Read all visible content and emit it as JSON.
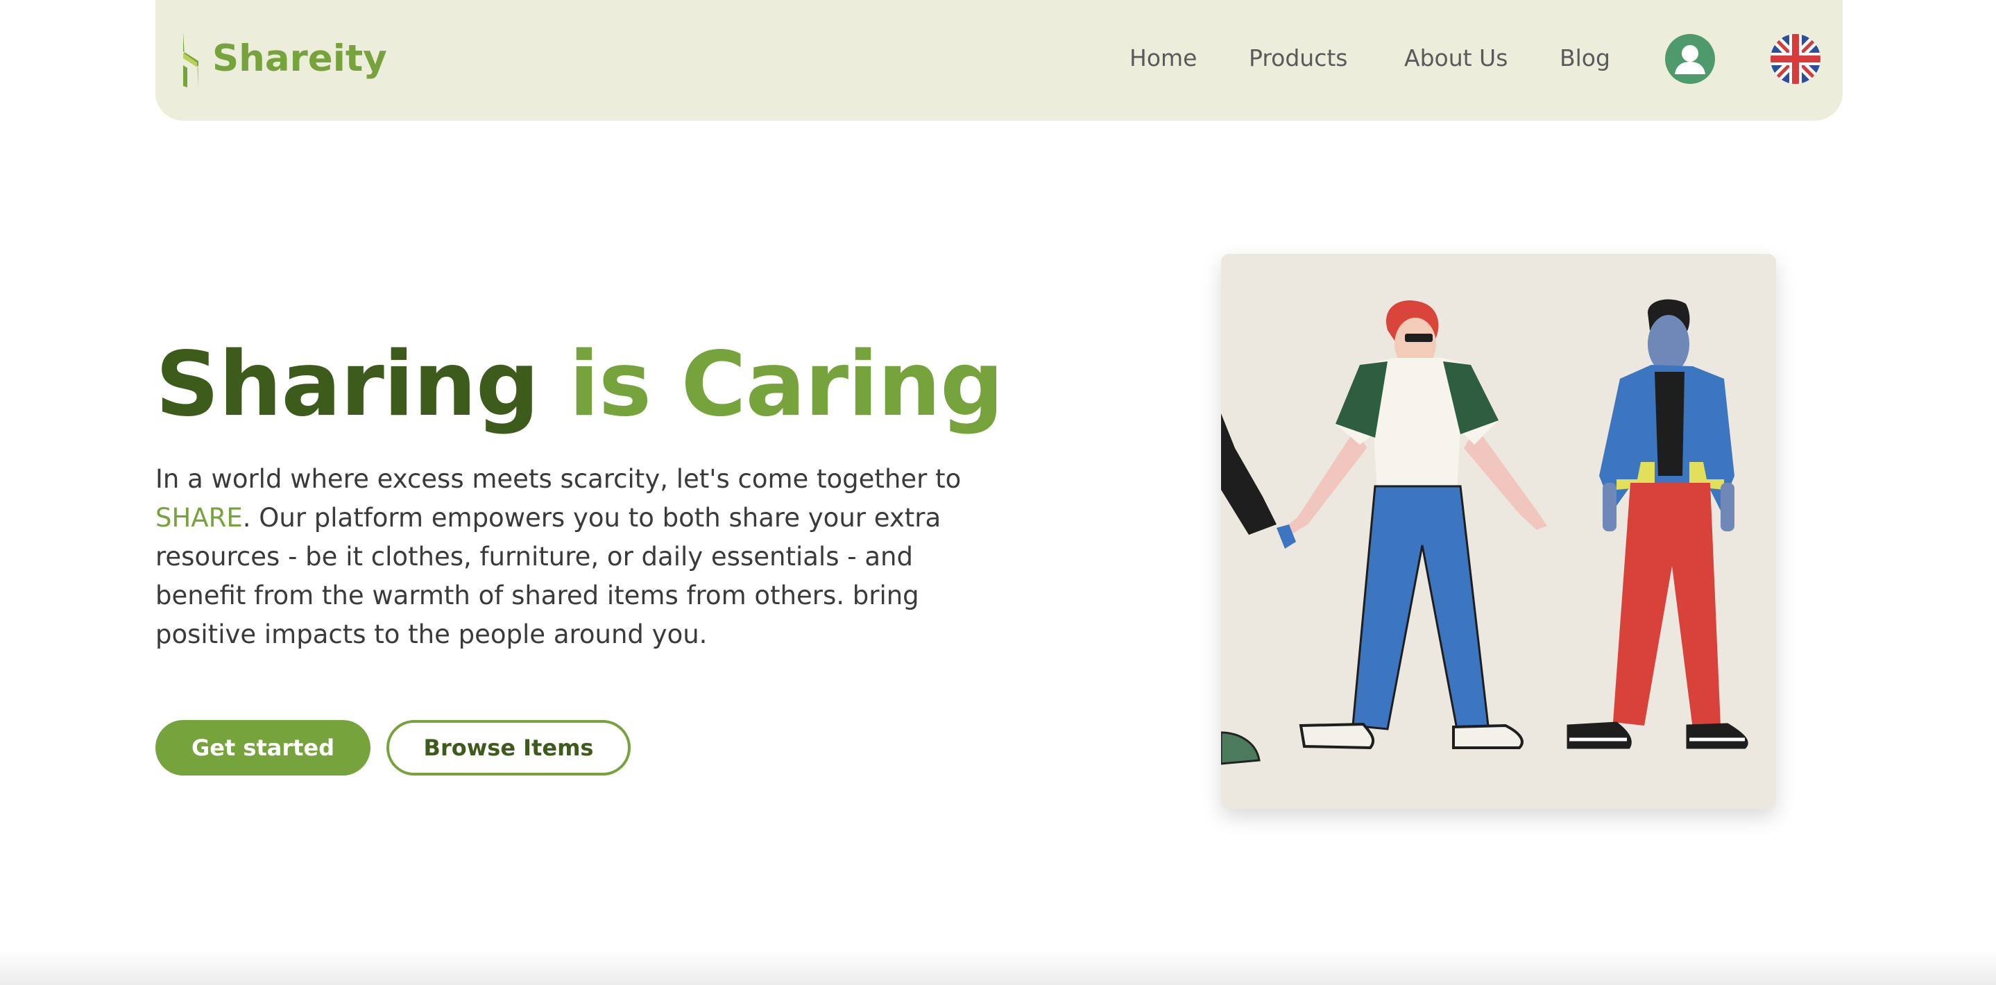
{
  "brand": {
    "name": "Shareity",
    "accent": "#76a33b",
    "dark": "#3d5c1c",
    "nav_bg": "#ecedda"
  },
  "nav": {
    "links": [
      "Home",
      "Products",
      "About Us",
      "Blog"
    ],
    "account_icon": "user-account-icon",
    "language_icon": "uk-flag-icon"
  },
  "hero": {
    "title_part1": "Sharing",
    "title_part2": "is Caring",
    "description_before": "In a world where excess meets scarcity, let's come together to ",
    "description_highlight": "SHARE",
    "description_after": ". Our platform empowers you to both share your extra resources - be it clothes, furniture, or daily essentials - and benefit from the warmth of shared items from others. bring positive impacts to the people around you.",
    "primary_button": "Get started",
    "secondary_button": "Browse Items",
    "image_icon": "people-holding-hands-illustration"
  }
}
